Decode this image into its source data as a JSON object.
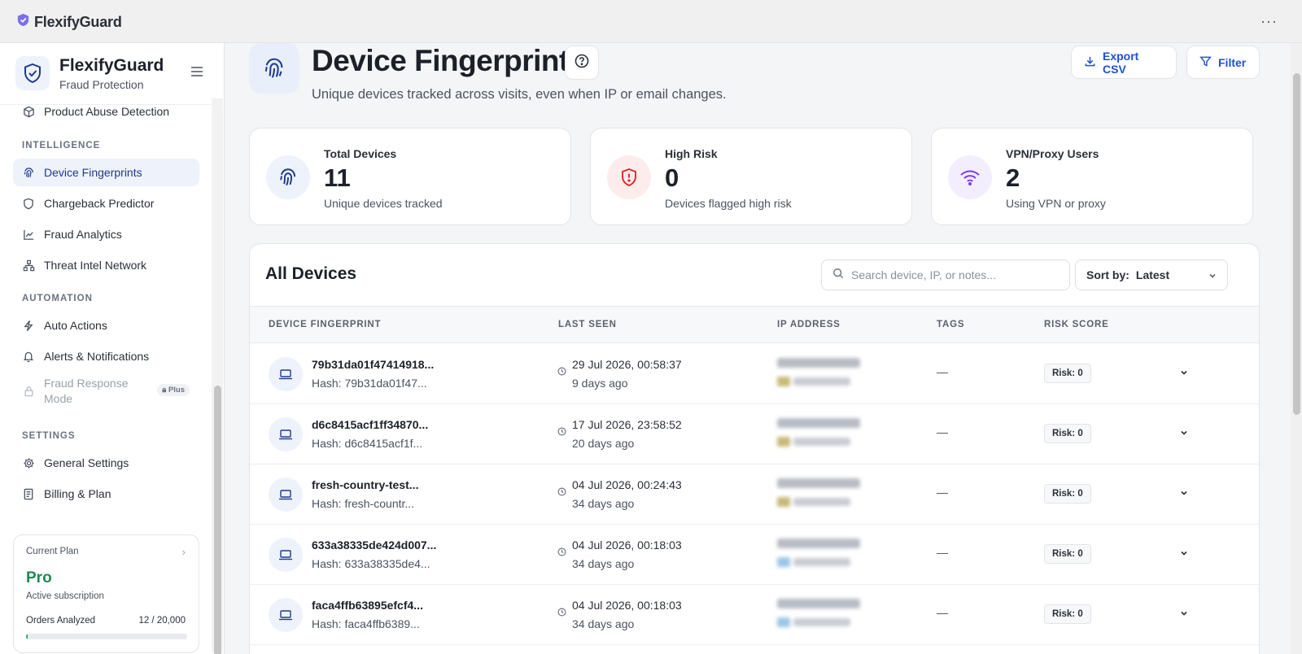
{
  "topbar": {
    "app_name": "FlexifyGuard",
    "more_label": "···"
  },
  "sidebar": {
    "title": "FlexifyGuard",
    "subtitle": "Fraud Protection",
    "partial_item": "Product Abuse Detection",
    "sections": {
      "intelligence": "INTELLIGENCE",
      "automation": "AUTOMATION",
      "settings": "SETTINGS"
    },
    "items": {
      "device_fingerprints": "Device Fingerprints",
      "chargeback_predictor": "Chargeback Predictor",
      "fraud_analytics": "Fraud Analytics",
      "threat_intel": "Threat Intel Network",
      "auto_actions": "Auto Actions",
      "alerts": "Alerts & Notifications",
      "fraud_response": "Fraud Response Mode",
      "fraud_response_badge": "Plus",
      "general_settings": "General Settings",
      "billing": "Billing & Plan"
    },
    "plan": {
      "label": "Current Plan",
      "name": "Pro",
      "status": "Active subscription",
      "orders_label": "Orders Analyzed",
      "orders_count": "12 / 20,000",
      "orders_fraction": 0.0006
    }
  },
  "page": {
    "title": "Device Fingerprints",
    "subtitle": "Unique devices tracked across visits, even when IP or email changes.",
    "export_label": "Export CSV",
    "filter_label": "Filter"
  },
  "stats": [
    {
      "label": "Total Devices",
      "value": "11",
      "desc": "Unique devices tracked",
      "icon": "fingerprint-icon",
      "color": "#1f3a8a"
    },
    {
      "label": "High Risk",
      "value": "0",
      "desc": "Devices flagged high risk",
      "icon": "shield-alert-icon",
      "color": "#dc2626"
    },
    {
      "label": "VPN/Proxy Users",
      "value": "2",
      "desc": "Using VPN or proxy",
      "icon": "wifi-icon",
      "color": "#7c3aed"
    }
  ],
  "table": {
    "title": "All Devices",
    "search_placeholder": "Search device, IP, or notes...",
    "sort_label": "Sort by:",
    "sort_value": "Latest",
    "columns": [
      "DEVICE FINGERPRINT",
      "LAST SEEN",
      "IP ADDRESS",
      "TAGS",
      "RISK SCORE"
    ],
    "rows": [
      {
        "fingerprint": "79b31da01f47414918...",
        "hash": "Hash: 79b31da01f47...",
        "last_seen": "29 Jul 2026, 00:58:37",
        "ago": "9 days ago",
        "tags": "—",
        "risk": "Risk: 0"
      },
      {
        "fingerprint": "d6c8415acf1ff34870...",
        "hash": "Hash: d6c8415acf1f...",
        "last_seen": "17 Jul 2026, 23:58:52",
        "ago": "20 days ago",
        "tags": "—",
        "risk": "Risk: 0"
      },
      {
        "fingerprint": "fresh-country-test...",
        "hash": "Hash: fresh-countr...",
        "last_seen": "04 Jul 2026, 00:24:43",
        "ago": "34 days ago",
        "tags": "—",
        "risk": "Risk: 0"
      },
      {
        "fingerprint": "633a38335de424d007...",
        "hash": "Hash: 633a38335de4...",
        "last_seen": "04 Jul 2026, 00:18:03",
        "ago": "34 days ago",
        "tags": "—",
        "risk": "Risk: 0"
      },
      {
        "fingerprint": "faca4ffb63895efcf4...",
        "hash": "Hash: faca4ffb6389...",
        "last_seen": "04 Jul 2026, 00:18:03",
        "ago": "34 days ago",
        "tags": "—",
        "risk": "Risk: 0"
      }
    ]
  },
  "colors": {
    "accent": "#1f4fd6",
    "brand_dark": "#1f3a8a",
    "success": "#1f8a53"
  }
}
